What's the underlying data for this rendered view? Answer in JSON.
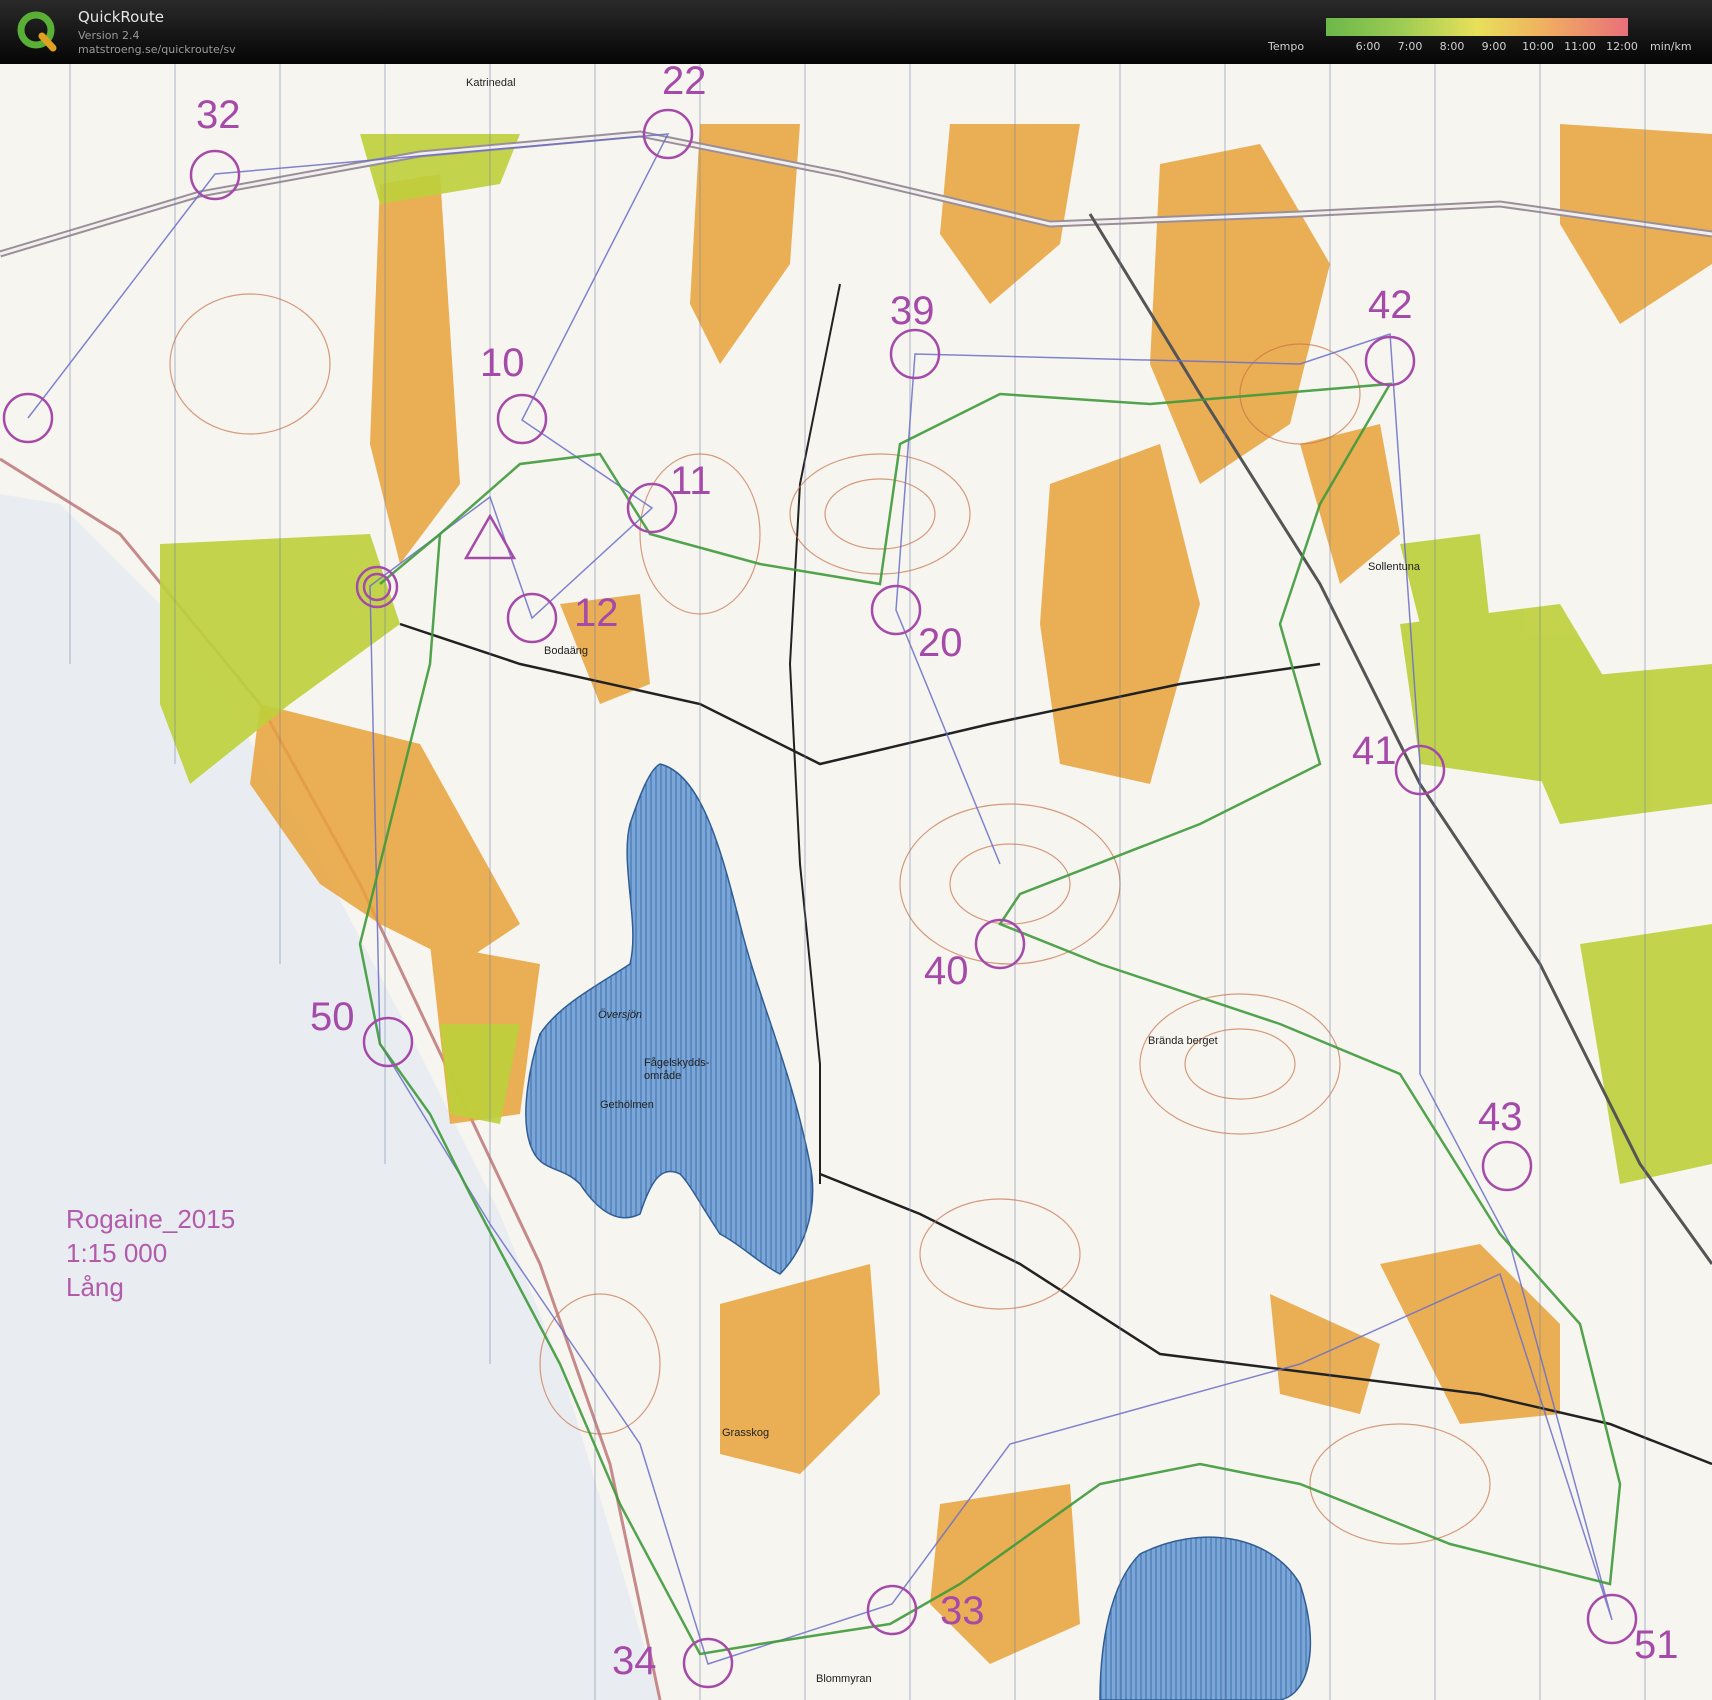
{
  "app": {
    "title": "QuickRoute",
    "version": "Version 2.4",
    "url": "matstroeng.se/quickroute/sv"
  },
  "tempo": {
    "label": "Tempo",
    "ticks": [
      "6:00",
      "7:00",
      "8:00",
      "9:00",
      "10:00",
      "11:00",
      "12:00"
    ],
    "unit": "min/km"
  },
  "map": {
    "controls": [
      "32",
      "22",
      "10",
      "11",
      "12",
      "39",
      "20",
      "42",
      "41",
      "40",
      "50",
      "43",
      "33",
      "34",
      "51"
    ],
    "place_names": [
      "Katrinedal",
      "Bodaäng",
      "Översjön",
      "Fågelskydds-",
      "område",
      "Gethölmen",
      "Brända berget",
      "Sollentuna",
      "Grasskog",
      "Blommyran"
    ],
    "info": [
      "Rogaine_2015",
      "1:15 000",
      "Lång"
    ]
  }
}
